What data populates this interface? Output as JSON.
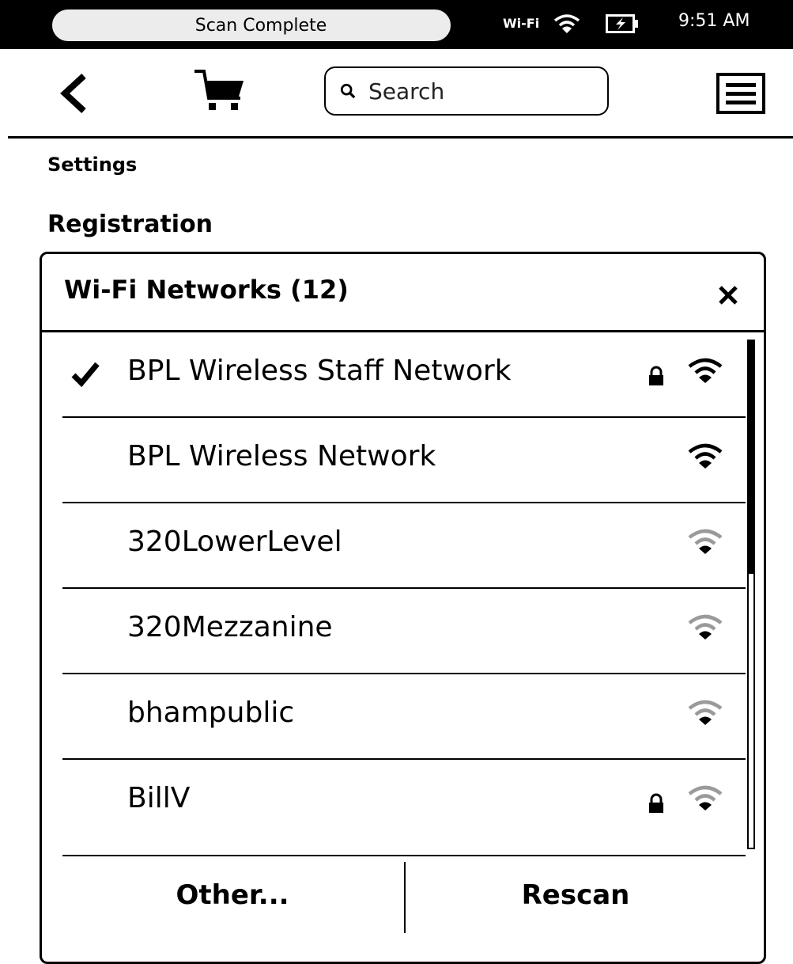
{
  "status_bar": {
    "message": "Scan Complete",
    "wifi_label": "Wi-Fi",
    "time": "9:51 AM"
  },
  "toolbar": {
    "back_icon": "chevron-left-icon",
    "cart_icon": "cart-icon",
    "search_placeholder": "Search",
    "menu_icon": "menu-icon"
  },
  "page": {
    "title": "Settings",
    "section": "Registration"
  },
  "dialog": {
    "title": "Wi-Fi Networks (12)",
    "networks": [
      {
        "name": "BPL Wireless Staff Network",
        "connected": true,
        "secured": true,
        "signal": "strong"
      },
      {
        "name": "BPL Wireless Network",
        "connected": false,
        "secured": false,
        "signal": "strong"
      },
      {
        "name": "320LowerLevel",
        "connected": false,
        "secured": false,
        "signal": "weak"
      },
      {
        "name": "320Mezzanine",
        "connected": false,
        "secured": false,
        "signal": "weak"
      },
      {
        "name": "bhampublic",
        "connected": false,
        "secured": false,
        "signal": "weak"
      },
      {
        "name": "BillV",
        "connected": false,
        "secured": true,
        "signal": "weak"
      }
    ],
    "other_label": "Other...",
    "rescan_label": "Rescan"
  },
  "colors": {
    "status_bar_bg": "#000000",
    "pill_bg": "#ececec",
    "weak_signal": "#9a9a9a"
  }
}
